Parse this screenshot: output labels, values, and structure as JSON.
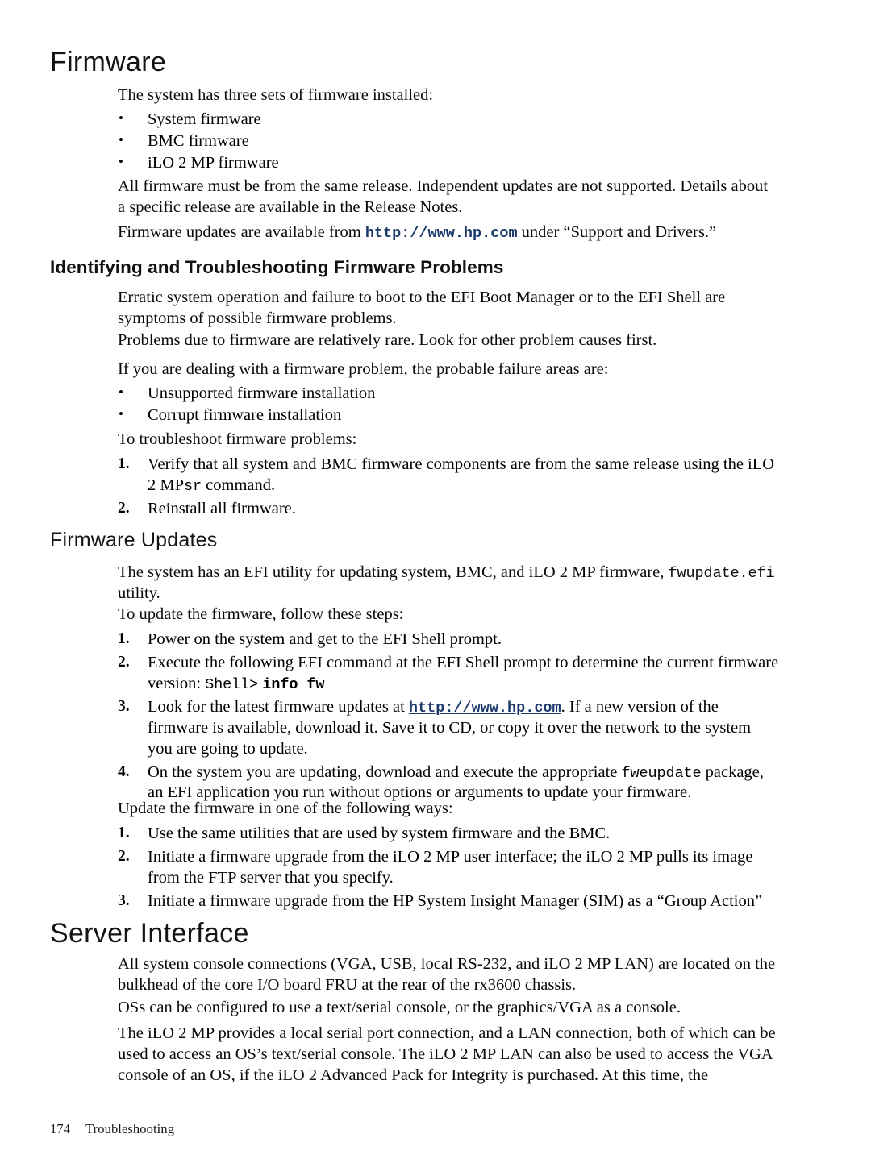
{
  "page": {
    "number": "174",
    "chapter": "Troubleshooting",
    "link_color": "#1b3a6b"
  },
  "sections": {
    "firmware": {
      "title": "Firmware",
      "intro": "The system has three sets of firmware installed:",
      "bullets": [
        "System firmware",
        "BMC firmware",
        "iLO 2 MP firmware"
      ],
      "para_release": "All firmware must be from the same release. Independent updates are not supported. Details about a specific release are available in the Release Notes.",
      "para_updates_prefix": "Firmware updates are available from ",
      "para_updates_url": "http://www.hp.com",
      "para_updates_suffix": " under “Support and Drivers.”"
    },
    "identifying": {
      "title": "Identifying and Troubleshooting Firmware Problems",
      "para_erratic": "Erratic system operation and failure to boot to the EFI Boot Manager or to the EFI Shell are symptoms of possible firmware problems.",
      "para_rare": "Problems due to firmware are relatively rare. Look for other problem causes first.",
      "para_dealing": "If you are dealing with a firmware problem, the probable failure areas are:",
      "bullets": [
        "Unsupported firmware installation",
        "Corrupt firmware installation"
      ],
      "para_troubleshoot": "To troubleshoot firmware problems:",
      "steps": [
        {
          "num": "1.",
          "text_before": "Verify that all system and BMC firmware components are from the same release using the iLO 2 MP",
          "code": "sr",
          "text_after": " command."
        },
        {
          "num": "2.",
          "text_before": "Reinstall all firmware.",
          "code": "",
          "text_after": ""
        }
      ]
    },
    "firmware_updates": {
      "title": "Firmware Updates",
      "para_utility_before": "The system has an EFI utility for updating system, BMC, and iLO 2 MP firmware, ",
      "para_utility_code": "fwupdate.efi",
      "para_utility_after": " utility.",
      "para_steps_intro": "To update the firmware, follow these steps:",
      "steps": [
        {
          "num": "1.",
          "parts": [
            {
              "type": "text",
              "value": "Power on the system and get to the EFI Shell prompt."
            }
          ]
        },
        {
          "num": "2.",
          "parts": [
            {
              "type": "text",
              "value": "Execute the following EFI command at the EFI Shell prompt to determine the current firmware version: "
            },
            {
              "type": "code",
              "value": "Shell>"
            },
            {
              "type": "text",
              "value": " "
            },
            {
              "type": "code-bold",
              "value": "info fw"
            }
          ]
        },
        {
          "num": "3.",
          "parts": [
            {
              "type": "text",
              "value": "Look for the latest firmware updates at "
            },
            {
              "type": "url",
              "value": "http://www.hp.com"
            },
            {
              "type": "text",
              "value": ". If a new version of the firmware is available, download it. Save it to CD, or copy it over the network to the system you are going to update."
            }
          ]
        },
        {
          "num": "4.",
          "parts": [
            {
              "type": "text",
              "value": "On the system you are updating, download and execute the appropriate "
            },
            {
              "type": "code",
              "value": "fweupdate"
            },
            {
              "type": "text",
              "value": " package, an EFI application you run without options or arguments to update your firmware."
            }
          ]
        }
      ],
      "para_ways_intro": "Update the firmware in one of the following ways:",
      "ways": [
        {
          "num": "1.",
          "text": "Use the same utilities that are used by system firmware and the BMC."
        },
        {
          "num": "2.",
          "text": "Initiate a firmware upgrade from the iLO 2 MP user interface; the iLO 2 MP pulls its image from the FTP server that you specify."
        },
        {
          "num": "3.",
          "text": "Initiate a firmware upgrade from the HP System Insight Manager (SIM) as a “Group Action”"
        }
      ]
    },
    "server_interface": {
      "title": "Server Interface",
      "para_connections": "All system console connections (VGA, USB, local RS-232, and iLO 2 MP LAN) are located on the bulkhead of the core I/O board FRU at the rear of the rx3600 chassis.",
      "para_os": "OSs can be configured to use a text/serial console, or the graphics/VGA as a console.",
      "para_ilo": "The iLO 2 MP provides a local serial port connection, and a LAN connection, both of which can be used to access an OS’s text/serial console. The iLO 2 MP LAN can also be used to access the VGA console of an OS, if the iLO 2 Advanced Pack for Integrity is purchased. At this time, the"
    }
  },
  "glyphs": {
    "bullet": "•"
  }
}
